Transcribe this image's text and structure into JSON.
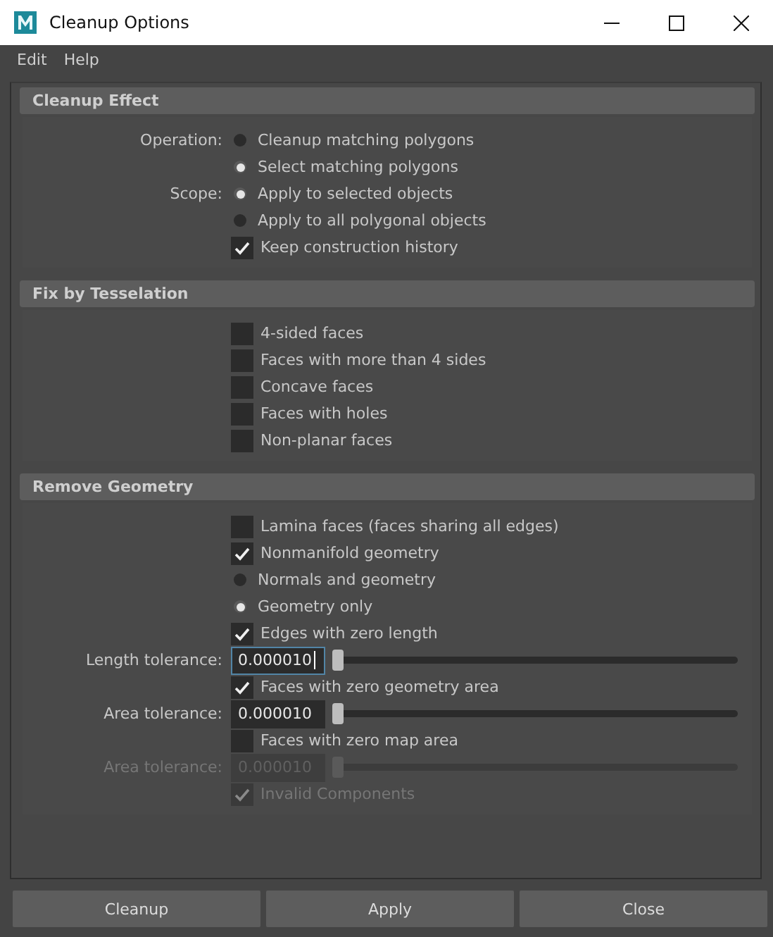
{
  "window": {
    "title": "Cleanup Options"
  },
  "menu": [
    "Edit",
    "Help"
  ],
  "sections": [
    {
      "title": "Cleanup Effect",
      "rows": [
        {
          "kind": "radio",
          "label": "Operation:",
          "text": "Cleanup matching polygons",
          "selected": false
        },
        {
          "kind": "radio",
          "text": "Select matching polygons",
          "selected": true
        },
        {
          "kind": "radio",
          "label": "Scope:",
          "text": "Apply to selected objects",
          "selected": true
        },
        {
          "kind": "radio",
          "text": "Apply to all polygonal objects",
          "selected": false
        },
        {
          "kind": "checkbox",
          "text": "Keep construction history",
          "checked": true,
          "disabled": false
        }
      ]
    },
    {
      "title": "Fix by Tesselation",
      "rows": [
        {
          "kind": "checkbox",
          "text": "4-sided faces",
          "checked": false,
          "disabled": false
        },
        {
          "kind": "checkbox",
          "text": "Faces with more than 4 sides",
          "checked": false,
          "disabled": false
        },
        {
          "kind": "checkbox",
          "text": "Concave faces",
          "checked": false,
          "disabled": false
        },
        {
          "kind": "checkbox",
          "text": "Faces with holes",
          "checked": false,
          "disabled": false
        },
        {
          "kind": "checkbox",
          "text": "Non-planar faces",
          "checked": false,
          "disabled": false
        }
      ]
    },
    {
      "title": "Remove Geometry",
      "rows": [
        {
          "kind": "checkbox",
          "text": "Lamina faces (faces sharing all edges)",
          "checked": false,
          "disabled": false
        },
        {
          "kind": "checkbox",
          "text": "Nonmanifold geometry",
          "checked": true,
          "disabled": false
        },
        {
          "kind": "radio",
          "text": "Normals and geometry",
          "selected": false
        },
        {
          "kind": "radio",
          "text": "Geometry only",
          "selected": true
        },
        {
          "kind": "checkbox",
          "text": "Edges with zero length",
          "checked": true,
          "disabled": false
        },
        {
          "kind": "field",
          "label": "Length tolerance:",
          "value": "0.000010",
          "level": 0,
          "focused": true,
          "disabled": false
        },
        {
          "kind": "checkbox",
          "text": "Faces with zero geometry area",
          "checked": true,
          "disabled": false
        },
        {
          "kind": "field",
          "label": "Area tolerance:",
          "value": "0.000010",
          "level": 0,
          "focused": false,
          "disabled": false
        },
        {
          "kind": "checkbox",
          "text": "Faces with zero map area",
          "checked": false,
          "disabled": false
        },
        {
          "kind": "field",
          "label": "Area tolerance:",
          "value": "0.000010",
          "level": 0,
          "focused": false,
          "disabled": true
        },
        {
          "kind": "checkbox",
          "text": "Invalid Components",
          "checked": true,
          "disabled": true
        }
      ]
    }
  ],
  "buttons": [
    "Cleanup",
    "Apply",
    "Close"
  ]
}
